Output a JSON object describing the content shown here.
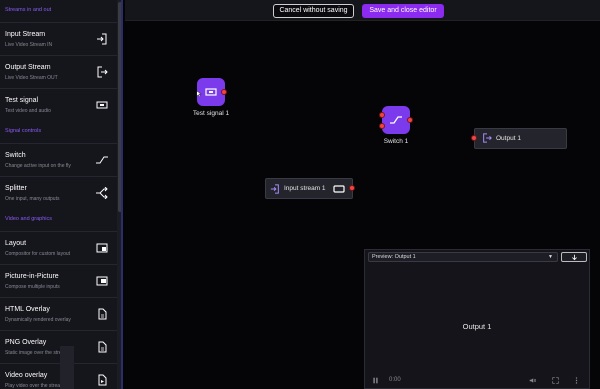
{
  "sidebar": {
    "sections": [
      {
        "title": "Streams in and out"
      },
      {
        "title": "Signal controls"
      },
      {
        "title": "Video and graphics"
      }
    ],
    "items": [
      {
        "title": "Input Stream",
        "subtitle": "Live Video Stream IN",
        "icon": "login-icon"
      },
      {
        "title": "Output Stream",
        "subtitle": "Live Video Stream OUT",
        "icon": "logout-icon"
      },
      {
        "title": "Test signal",
        "subtitle": "Test video and audio",
        "icon": "test-signal-icon"
      },
      {
        "title": "Switch",
        "subtitle": "Change active input on the fly",
        "icon": "switch-icon"
      },
      {
        "title": "Splitter",
        "subtitle": "One input, many outputs",
        "icon": "split-icon"
      },
      {
        "title": "Layout",
        "subtitle": "Compositor for custom layout",
        "icon": "layout-icon"
      },
      {
        "title": "Picture-in-Picture",
        "subtitle": "Compose multiple inputs",
        "icon": "pip-icon"
      },
      {
        "title": "HTML Overlay",
        "subtitle": "Dynamically rendered overlay",
        "icon": "file-icon"
      },
      {
        "title": "PNG Overlay",
        "subtitle": "Static image over the stream",
        "icon": "file-icon"
      },
      {
        "title": "Video overlay",
        "subtitle": "Play video over the stream",
        "icon": "video-file-icon"
      }
    ]
  },
  "toolbar": {
    "cancel_label": "Cancel without saving",
    "save_label": "Save and close editor"
  },
  "nodes": {
    "test_signal": {
      "label": "Test signal 1"
    },
    "switch": {
      "label": "Switch 1"
    },
    "output": {
      "label": "Output 1"
    },
    "input_stream": {
      "label": "Input stream 1"
    }
  },
  "preview": {
    "selected": "Preview: Output 1",
    "video_label": "Output 1",
    "time": "0:00"
  },
  "colors": {
    "accent": "#8b2bf0",
    "node": "#7c3aed",
    "port": "#ef4444",
    "section": "#8b5cf6"
  }
}
